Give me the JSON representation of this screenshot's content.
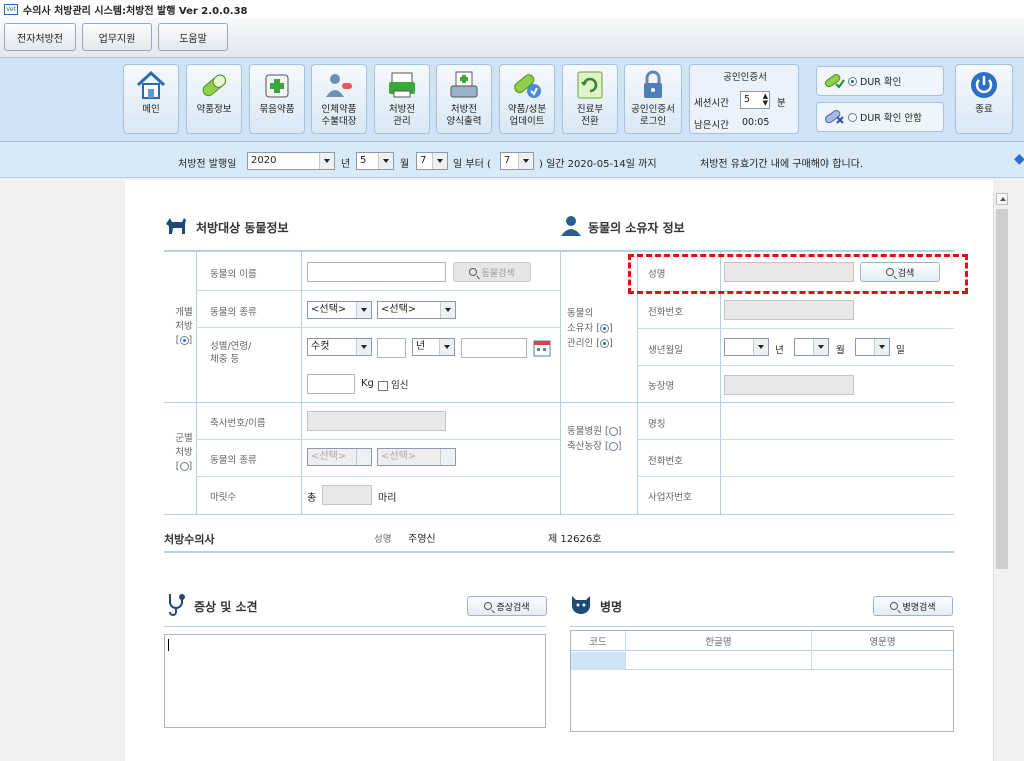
{
  "app": {
    "logo": "Vet",
    "title": "수의사 처방관리 시스템:처방전 발행 Ver 2.0.0.38"
  },
  "menu": [
    "전자처방전",
    "업무지원",
    "도움말"
  ],
  "toolbar": {
    "buttons": [
      {
        "l1": "메인",
        "l2": ""
      },
      {
        "l1": "약품정보",
        "l2": ""
      },
      {
        "l1": "묶음약품",
        "l2": ""
      },
      {
        "l1": "인체약품",
        "l2": "수불대장"
      },
      {
        "l1": "처방전",
        "l2": "관리"
      },
      {
        "l1": "처방전",
        "l2": "양식출력"
      },
      {
        "l1": "약품/성분",
        "l2": "업데이트"
      },
      {
        "l1": "진료부",
        "l2": "전환"
      },
      {
        "l1": "공인인증서",
        "l2": "로그인"
      }
    ],
    "cert": {
      "title": "공인인증서",
      "session_label": "세션시간",
      "session_value": "5",
      "session_unit": "분",
      "remain_label": "남은시간",
      "remain_value": "00:05"
    },
    "dur_on": "DUR 확인",
    "dur_off": "DUR 확인 안함",
    "exit": "종료"
  },
  "datebar": {
    "label": "처방전 발행일",
    "year": "2020",
    "year_unit": "년",
    "month": "5",
    "month_unit": "월",
    "day": "7",
    "day_unit": "일 부터 (",
    "days": "7",
    "days_unit": ") 일간 2020-05-14일 까지",
    "notice": "처방전 유효기간 내에 구매해야 합니다."
  },
  "animal": {
    "section": "처방대상 동물정보",
    "individual": {
      "l1": "개별",
      "l2": "처방"
    },
    "group": {
      "l1": "군별",
      "l2": "처방"
    },
    "name_label": "동물의 이름",
    "search_btn": "동물검색",
    "kind_label": "동물의 종류",
    "select_placeholder": "<선택>",
    "sex_label_1": "성별/연령/",
    "sex_label_2": "체중 등",
    "sex_value": "수컷",
    "year_unit": "년",
    "kg": "Kg",
    "pregnant": "임신",
    "farm_label": "축사번호/이름",
    "group_kind_label": "동물의 종류",
    "count_label": "마릿수",
    "count_prefix": "총",
    "count_unit": "마리"
  },
  "owner": {
    "section": "동물의 소유자 정보",
    "manager_l1": "동물의",
    "manager_l2": "소유자",
    "manager_l3": "관리인",
    "hospital_l1": "동물병원",
    "hospital_l2": "축산농장",
    "name_label": "성명",
    "search_btn": "검색",
    "phone_label": "전화번호",
    "birth_label": "생년월일",
    "year_unit": "년",
    "month_unit": "월",
    "day_unit": "일",
    "farm_label": "농장명",
    "org_label": "명칭",
    "org_phone_label": "전화번호",
    "biz_label": "사업자번호"
  },
  "vet": {
    "section": "처방수의사",
    "name_label": "성명",
    "name": "주영신",
    "license": "제 12626호"
  },
  "symptom": {
    "section": "증상 및 소견",
    "search_btn": "증상검색"
  },
  "disease": {
    "section": "병명",
    "search_btn": "병명검색",
    "columns": [
      "코드",
      "한글명",
      "영문명"
    ]
  },
  "colors": {
    "toolbar": "#cfe3f4",
    "accent": "#1a6fd0",
    "highlight": "#e01010"
  }
}
